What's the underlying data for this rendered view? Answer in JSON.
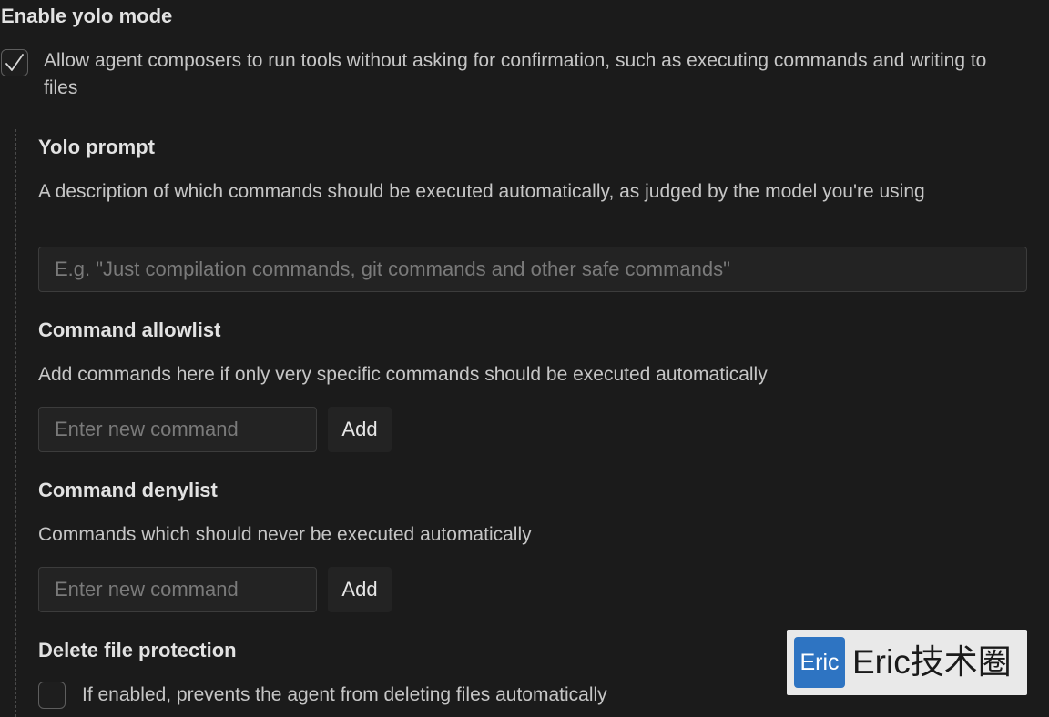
{
  "yolo": {
    "title": "Enable yolo mode",
    "checkbox_checked": true,
    "checkbox_label": "Allow agent composers to run tools without asking for confirmation, such as executing commands and writing to files"
  },
  "prompt": {
    "title": "Yolo prompt",
    "description": "A description of which commands should be executed automatically, as judged by the model you're using",
    "placeholder": "E.g. \"Just compilation commands, git commands and other safe commands\"",
    "value": ""
  },
  "allowlist": {
    "title": "Command allowlist",
    "description": "Add commands here if only very specific commands should be executed automatically",
    "placeholder": "Enter new command",
    "add_label": "Add"
  },
  "denylist": {
    "title": "Command denylist",
    "description": "Commands which should never be executed automatically",
    "placeholder": "Enter new command",
    "add_label": "Add"
  },
  "delete_protection": {
    "title": "Delete file protection",
    "checkbox_checked": false,
    "checkbox_label": "If enabled, prevents the agent from deleting files automatically"
  },
  "watermark": {
    "logo_text": "Eric",
    "text": "Eric技术圈"
  },
  "colors": {
    "background": "#1b1b1b",
    "check": "#d8d8d8",
    "watermark_logo": "#2e74c2"
  }
}
